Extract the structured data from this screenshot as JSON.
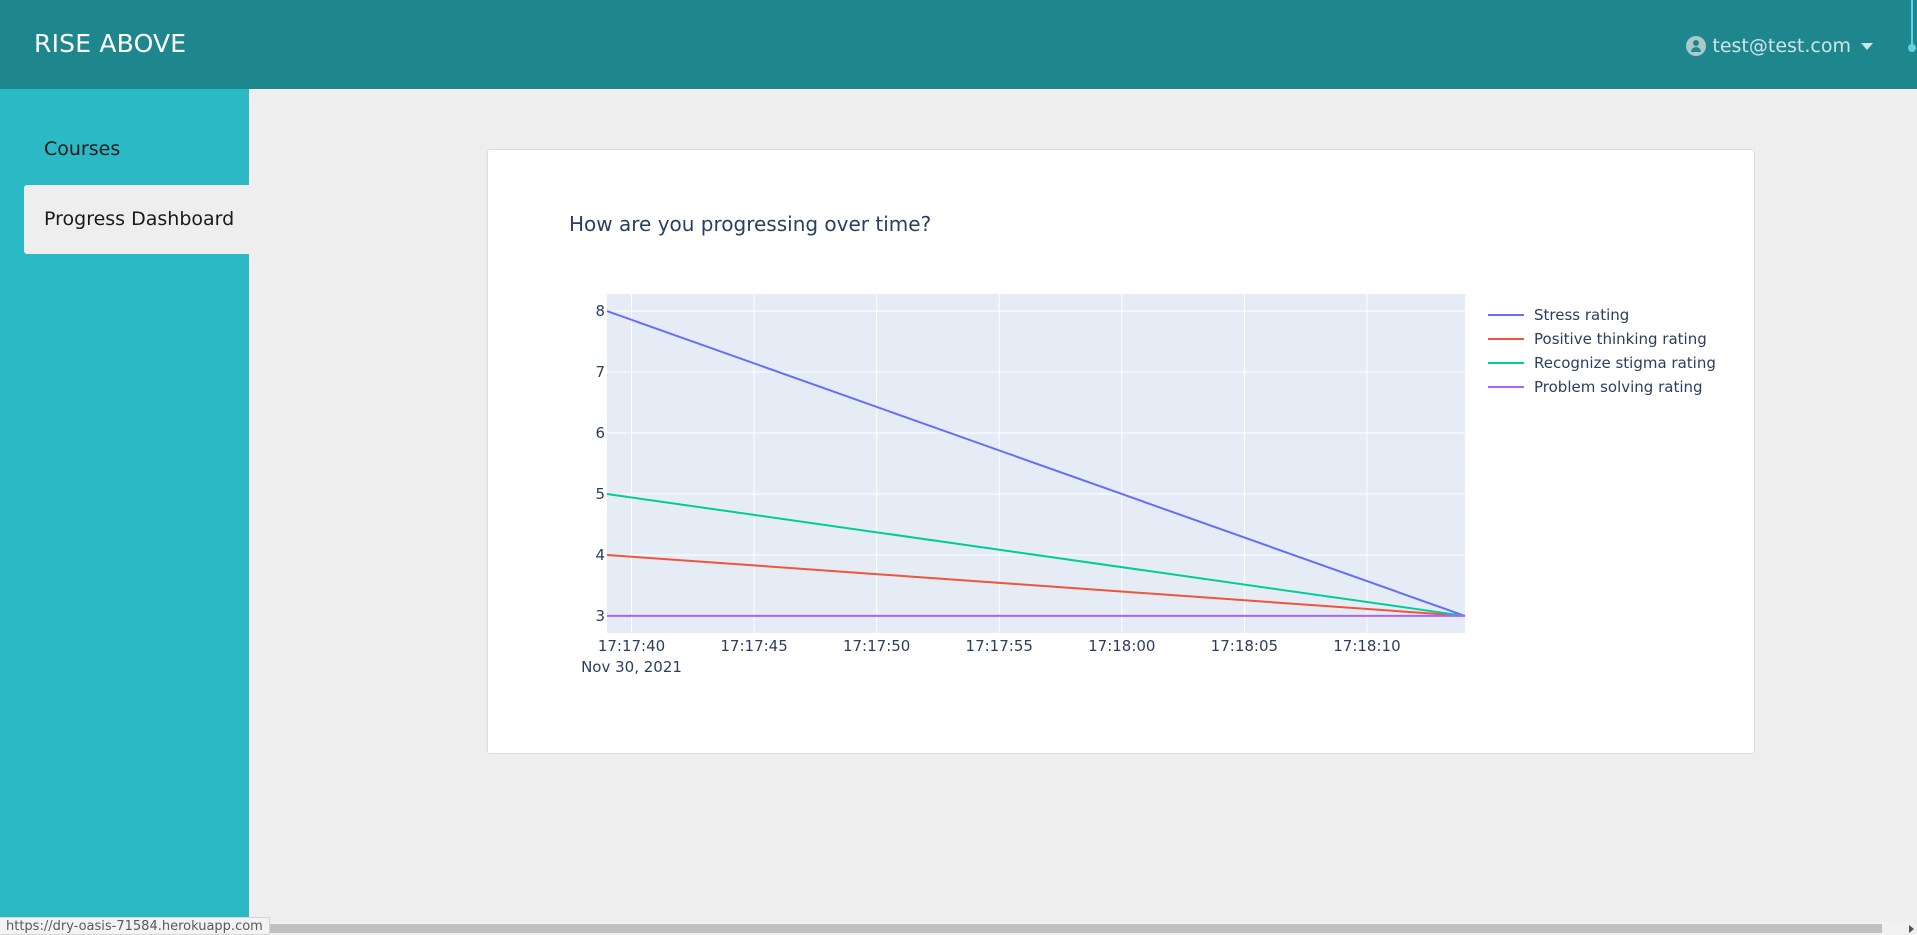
{
  "app": {
    "brand": "RISE ABOVE",
    "user_email": "test@test.com"
  },
  "sidebar": {
    "items": [
      {
        "label": "Courses",
        "active": false
      },
      {
        "label": "Progress Dashboard",
        "active": true
      }
    ]
  },
  "chart_data": {
    "type": "line",
    "title": "How are you progressing over time?",
    "xlabel": "",
    "ylabel": "",
    "x": [
      "2021-11-30 17:17:39",
      "2021-11-30 17:18:14"
    ],
    "x_ticks": [
      "17:17:40",
      "17:17:45",
      "17:17:50",
      "17:17:55",
      "17:18:00",
      "17:18:05",
      "17:18:10"
    ],
    "x_tick_sublabel": "Nov 30, 2021",
    "y_ticks": [
      3,
      4,
      5,
      6,
      7,
      8
    ],
    "ylim": [
      2.72,
      8.28
    ],
    "grid": true,
    "legend_position": "right",
    "series": [
      {
        "name": "Stress rating",
        "values": [
          8,
          3
        ],
        "color": "#636efa"
      },
      {
        "name": "Positive thinking rating",
        "values": [
          4,
          3
        ],
        "color": "#ef553b"
      },
      {
        "name": "Recognize stigma rating",
        "values": [
          5,
          3
        ],
        "color": "#00cc96"
      },
      {
        "name": "Problem solving rating",
        "values": [
          3,
          3
        ],
        "color": "#ab63fa"
      }
    ]
  },
  "status_url": "https://dry-oasis-71584.herokuapp.com"
}
